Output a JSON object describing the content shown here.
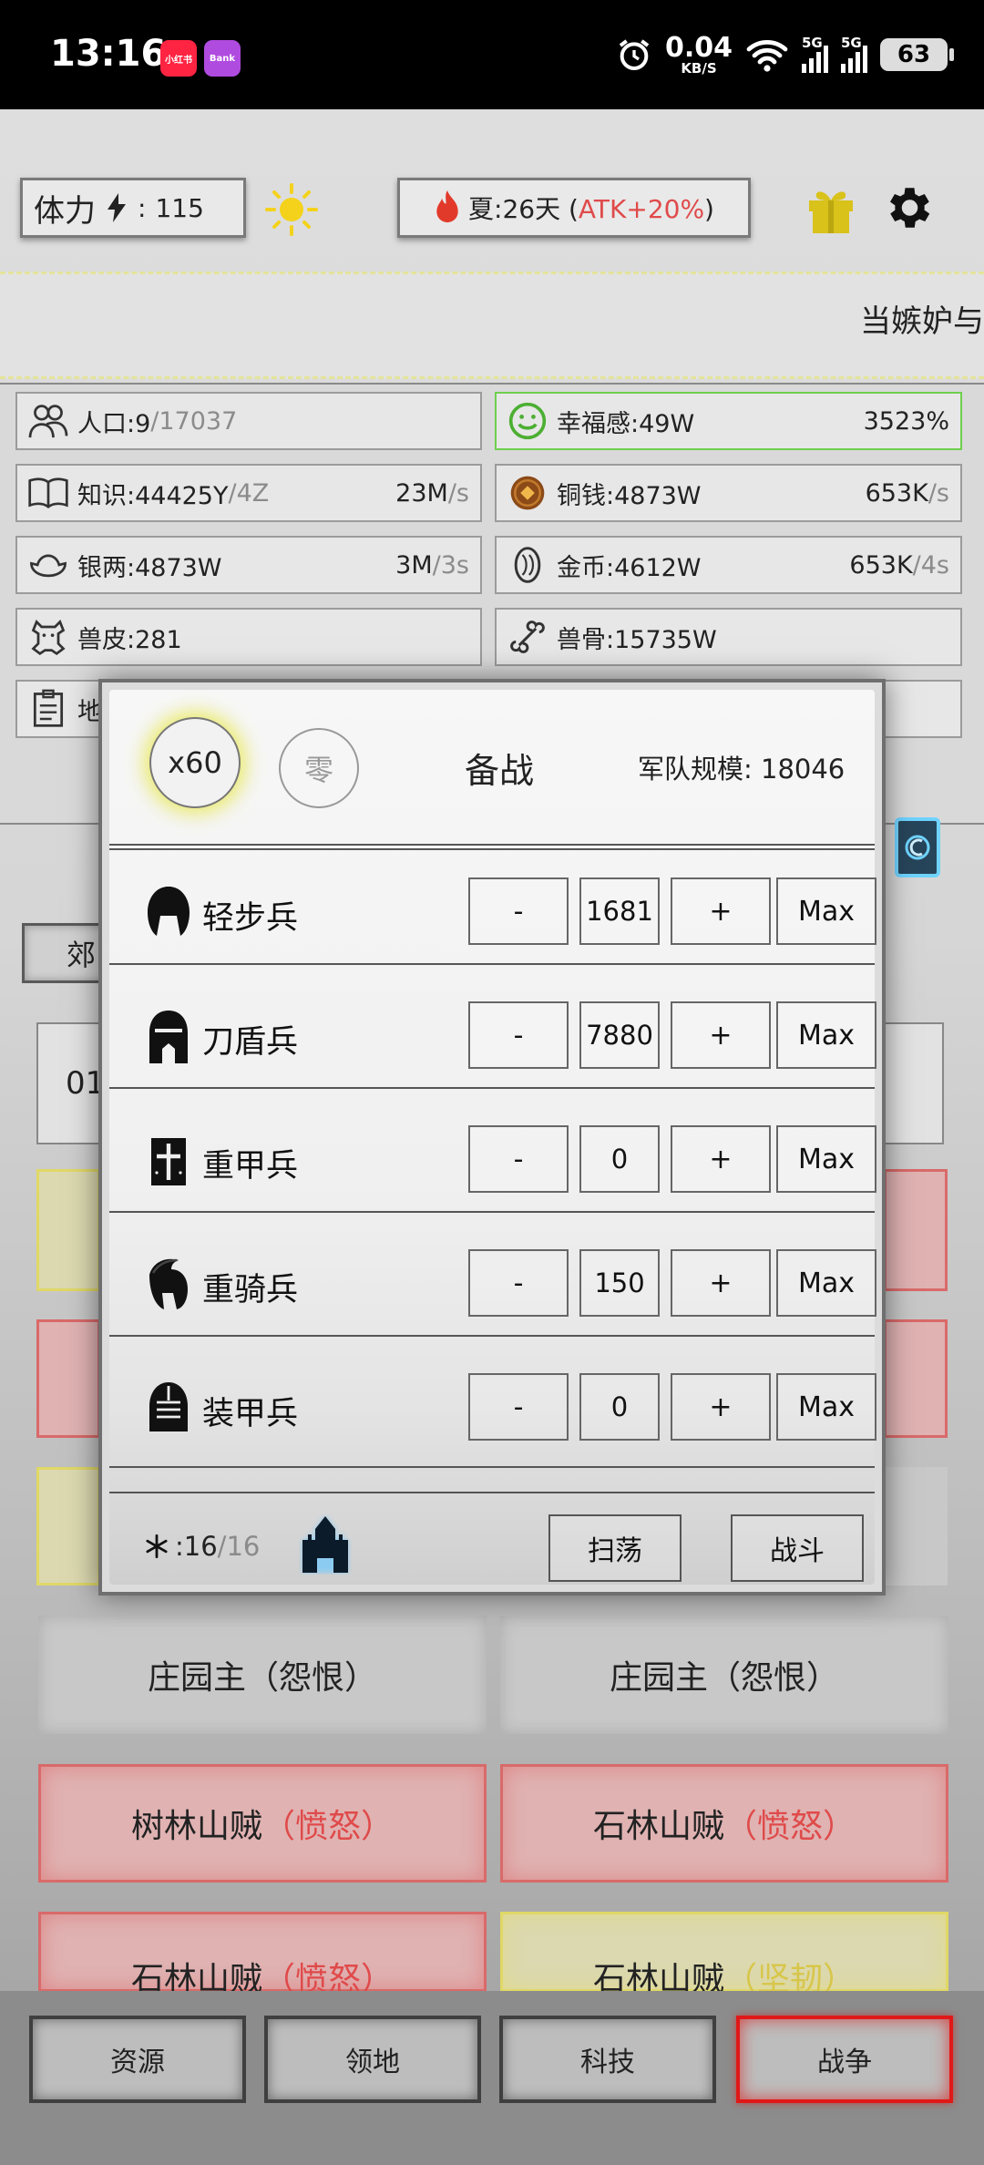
{
  "status_bar": {
    "time": "13:16",
    "app_badges": [
      {
        "label": "小红书",
        "color": "#ff2442"
      },
      {
        "label": "Bank",
        "color": "#b04be0"
      }
    ],
    "net_speed_value": "0.04",
    "net_speed_unit": "KB/S",
    "signal1_label": "5G",
    "signal2_label": "5G",
    "battery": "63"
  },
  "top": {
    "stamina_label": "体力",
    "stamina_sep": ":",
    "stamina_value": "115",
    "season_prefix": "夏:26天 (",
    "season_bonus": "ATK+20%",
    "season_suffix": ")",
    "ticker_text": "当嫉妒与"
  },
  "resources": [
    {
      "icon": "people-icon",
      "label": "人口:9",
      "extra": "/17037",
      "rate": "",
      "rate_unit": ""
    },
    {
      "icon": "smile-icon",
      "label": "幸福感:49W",
      "extra": "",
      "rate": "3523%",
      "rate_unit": ""
    },
    {
      "icon": "book-icon",
      "label": "知识:44425Y",
      "extra": "/4Z",
      "rate": "23M",
      "rate_unit": "/s"
    },
    {
      "icon": "copper-coin-icon",
      "label": "铜钱:4873W",
      "extra": "",
      "rate": "653K",
      "rate_unit": "/s"
    },
    {
      "icon": "silver-ingot-icon",
      "label": "银两:4873W",
      "extra": "",
      "rate": "3M",
      "rate_unit": "/3s"
    },
    {
      "icon": "gold-coin-icon",
      "label": "金币:4612W",
      "extra": "",
      "rate": "653K",
      "rate_unit": "/4s"
    },
    {
      "icon": "hide-icon",
      "label": "兽皮:281",
      "extra": "",
      "rate": "",
      "rate_unit": ""
    },
    {
      "icon": "bone-icon",
      "label": "兽骨:15735W",
      "extra": "",
      "rate": "",
      "rate_unit": ""
    },
    {
      "icon": "map-icon",
      "label": "地",
      "extra": "",
      "rate": "",
      "rate_unit": ""
    }
  ],
  "peek": {
    "tab_partial": "郊",
    "field_partial": "01"
  },
  "targets": [
    {
      "name": "庄园主",
      "tag": "（怨恨）",
      "style": "gray"
    },
    {
      "name": "庄园主",
      "tag": "（怨恨）",
      "style": "gray"
    },
    {
      "name": "树林山贼",
      "tag": "（愤怒）",
      "style": "red"
    },
    {
      "name": "石林山贼",
      "tag": "（愤怒）",
      "style": "red"
    },
    {
      "name": "石林山贼",
      "tag": "（愤怒）",
      "style": "red"
    },
    {
      "name": "石林山贼",
      "tag": "（坚韧）",
      "style": "yellow"
    }
  ],
  "bottom_nav": [
    {
      "label": "资源",
      "active": false
    },
    {
      "label": "领地",
      "active": false
    },
    {
      "label": "科技",
      "active": false
    },
    {
      "label": "战争",
      "active": true
    }
  ],
  "dialog": {
    "multiplier": "x60",
    "zero_label": "零",
    "title": "备战",
    "army_label": "军队规模:",
    "army_value": "18046",
    "minus": "-",
    "plus": "+",
    "max": "Max",
    "units": [
      {
        "name": "轻步兵",
        "qty": "1681",
        "icon": "light-infantry-helmet-icon"
      },
      {
        "name": "刀盾兵",
        "qty": "7880",
        "icon": "sword-shield-helmet-icon"
      },
      {
        "name": "重甲兵",
        "qty": "0",
        "icon": "heavy-armor-helmet-icon"
      },
      {
        "name": "重骑兵",
        "qty": "150",
        "icon": "heavy-cavalry-helmet-icon"
      },
      {
        "name": "装甲兵",
        "qty": "0",
        "icon": "armored-helmet-icon"
      }
    ],
    "energy_current": ":16",
    "energy_max": "/16",
    "sweep_label": "扫荡",
    "battle_label": "战斗"
  },
  "colors": {
    "accent_red": "#e04a4a",
    "accent_yellow": "#d7c64a",
    "active_border": "#e01818",
    "happiness_border": "#6fcf4e"
  }
}
